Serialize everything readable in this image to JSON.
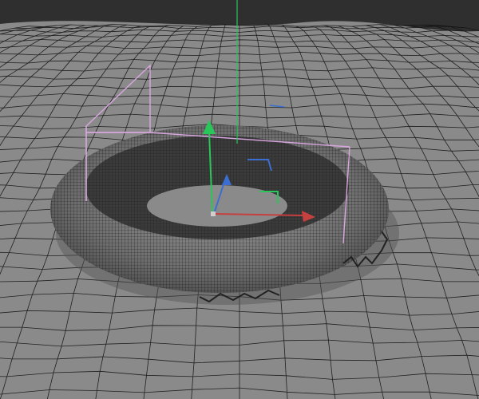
{
  "viewport": {
    "background_color": "#2f2f2f",
    "ground_color": "#8a8a8a",
    "wire_color": "#101010",
    "torus_fill": "#7a7a7a",
    "bbox_color": "#d9a6df"
  },
  "gizmo": {
    "y_axis_color": "#29c65a",
    "x_axis_color": "#c64040",
    "z_axis_color": "#3a6fd1",
    "pivot_color": "#cfcfcf",
    "icons": [
      "move-y-arrow-icon",
      "move-x-arrow-icon",
      "move-z-arrow-icon",
      "plane-handle-icon"
    ]
  }
}
